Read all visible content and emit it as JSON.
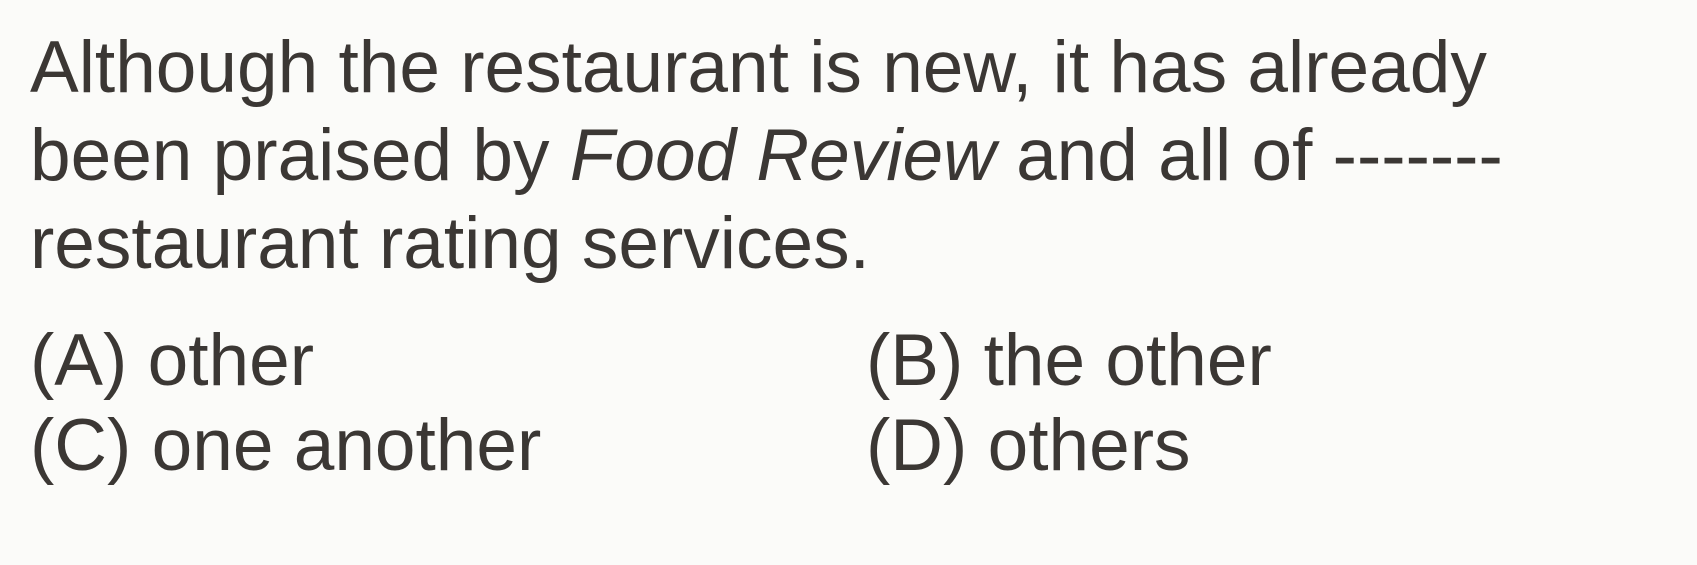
{
  "question": {
    "line1": "Although the restaurant is new, it has already",
    "line2_before": "been praised by ",
    "line2_title": "Food Review",
    "line2_after": " and all of -------",
    "line3": "restaurant rating services."
  },
  "options": [
    {
      "letter": "(A)",
      "text": "other"
    },
    {
      "letter": "(B)",
      "text": "the other"
    },
    {
      "letter": "(C)",
      "text": "one another"
    },
    {
      "letter": "(D)",
      "text": "others"
    }
  ]
}
